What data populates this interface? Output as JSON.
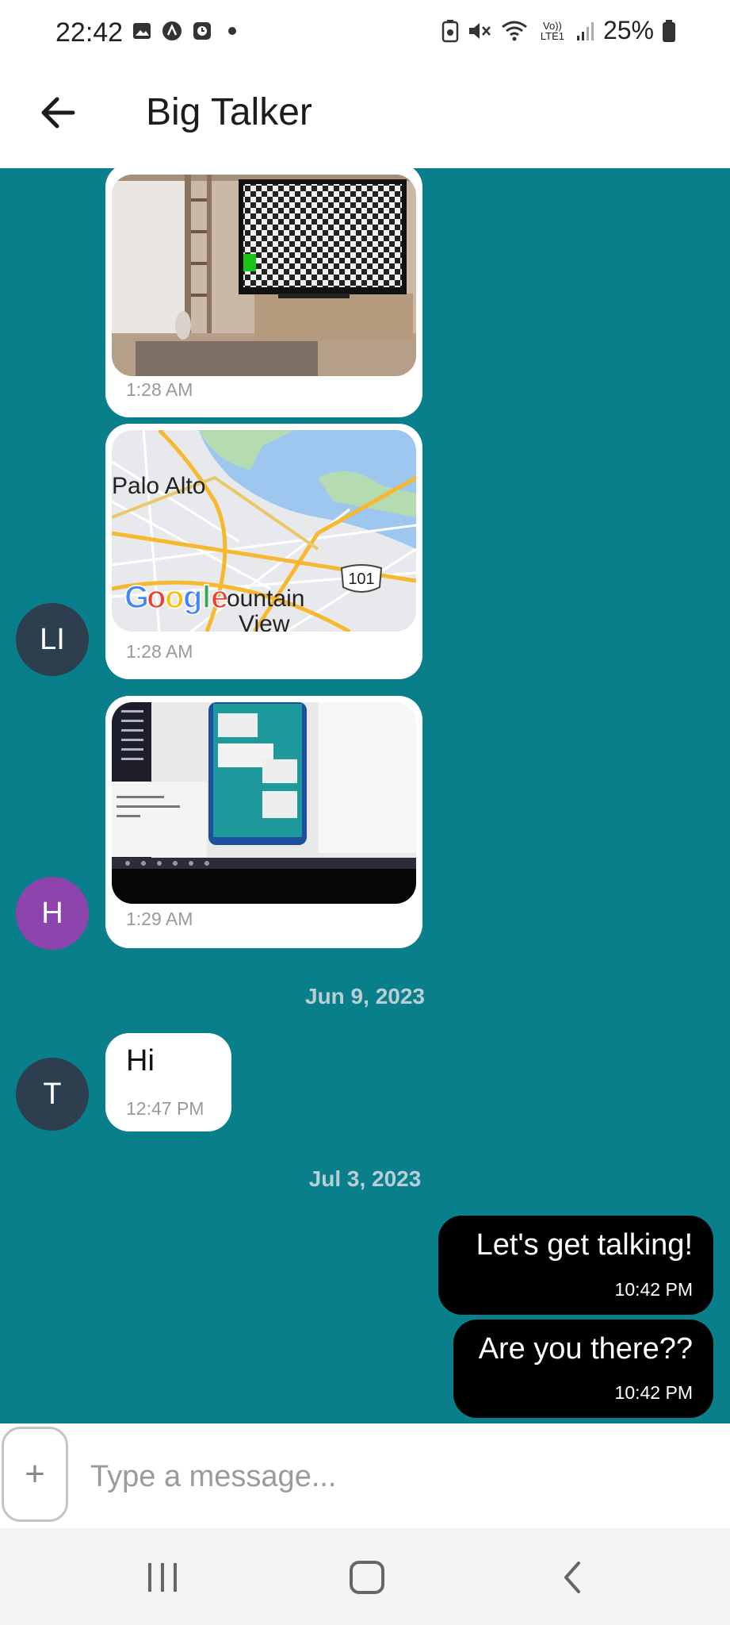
{
  "status_bar": {
    "time": "22:42",
    "network_label": "Vo)) LTE1",
    "battery": "25%"
  },
  "header": {
    "title": "Big Talker"
  },
  "messages": {
    "m1_time": "1:28 AM",
    "m2_time": "1:28 AM",
    "map_city1": "Palo Alto",
    "map_city2a": "ountain",
    "map_city2b": "View",
    "map_route": "101",
    "map_brand": [
      "G",
      "o",
      "o",
      "g",
      "l",
      "e"
    ],
    "m3_time": "1:29 AM",
    "date1": "Jun 9, 2023",
    "m4_text": "Hi",
    "m4_time": "12:47 PM",
    "date2": "Jul 3, 2023",
    "m5_text": "Let's get talking!",
    "m5_time": "10:42 PM",
    "m6_text": "Are you there??",
    "m6_time": "10:42 PM"
  },
  "avatars": [
    {
      "initials": "LI",
      "color": "#2d3e4f"
    },
    {
      "initials": "H",
      "color": "#8e44ad"
    },
    {
      "initials": "T",
      "color": "#2d3e4f"
    }
  ],
  "composer": {
    "attach_label": "+",
    "placeholder": "Type a message..."
  },
  "colors": {
    "chat_background": "#0a7f8c",
    "outgoing_bubble": "#000000",
    "incoming_bubble": "#ffffff"
  },
  "icons": [
    "gallery-icon",
    "app-icon",
    "clock-icon",
    "battery-saver-icon",
    "mute-icon",
    "wifi-icon",
    "signal-icon",
    "battery-icon",
    "back-arrow-icon",
    "plus-icon",
    "recents-icon",
    "home-icon",
    "back-nav-icon"
  ]
}
